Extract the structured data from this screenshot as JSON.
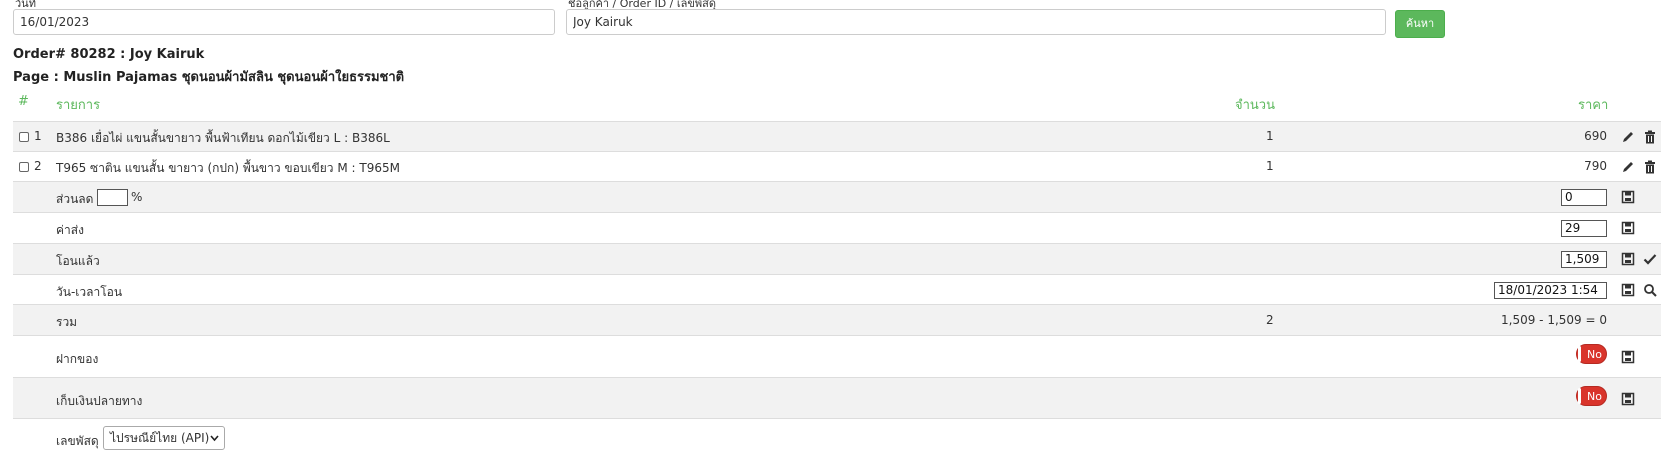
{
  "search": {
    "date_label": "วันที่",
    "date_value": "16/01/2023",
    "query_label": "ชื่อลูกค้า / Order ID / เลขพัสดุ",
    "query_value": "Joy Kairuk",
    "button_label": "ค้นหา"
  },
  "order": {
    "title": "Order# 80282 : Joy Kairuk",
    "page": "Page : Muslin Pajamas ชุดนอนผ้ามัสลิน ชุดนอนผ้าใยธรรมชาติ"
  },
  "table": {
    "headers": {
      "index": "#",
      "item": "รายการ",
      "qty": "จำนวน",
      "price": "ราคา"
    },
    "items": [
      {
        "index": "1",
        "name": "B386 เยื่อไผ่ แขนสั้นขายาว พื้นฟ้าเทียน ดอกไม้เขียว L : B386L",
        "qty": "1",
        "price": "690"
      },
      {
        "index": "2",
        "name": "T965 ซาติน แขนสั้น ขายาว (กปก) พื้นขาว ขอบเขียว M : T965M",
        "qty": "1",
        "price": "790"
      }
    ]
  },
  "summary": {
    "discount_label": "ส่วนลด",
    "discount_percent_value": "",
    "discount_unit": "%",
    "discount_value": "0",
    "shipping_label": "ค่าส่ง",
    "shipping_value": "29",
    "paid_label": "โอนแล้ว",
    "paid_value": "1,509",
    "transfer_time_label": "วัน-เวลาโอน",
    "transfer_time_value": "18/01/2023 1:54",
    "total_label": "รวม",
    "total_qty": "2",
    "total_value": "1,509 - 1,509 = 0",
    "deposit_label": "ฝากของ",
    "deposit_toggle": "No",
    "cod_label": "เก็บเงินปลายทาง",
    "cod_toggle": "No",
    "tracking_label": "เลขพัสดุ",
    "tracking_carrier": "ไปรษณีย์ไทย (API)"
  },
  "colors": {
    "accent": "#5cb85c",
    "danger": "#d9342b"
  }
}
